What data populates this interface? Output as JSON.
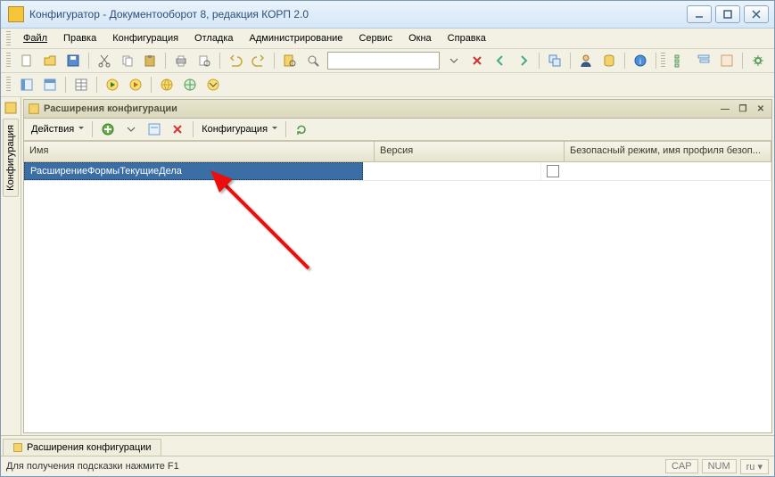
{
  "window": {
    "title": "Конфигуратор - Документооборот 8, редакция КОРП 2.0"
  },
  "menu": {
    "file": "Файл",
    "edit": "Правка",
    "config": "Конфигурация",
    "debug": "Отладка",
    "admin": "Администрирование",
    "service": "Сервис",
    "windows": "Окна",
    "help": "Справка"
  },
  "sidebar": {
    "tab_label": "Конфигурация"
  },
  "child": {
    "title": "Расширения конфигурации",
    "toolbar": {
      "actions": "Действия",
      "config": "Конфигурация"
    },
    "columns": {
      "name": "Имя",
      "version": "Версия",
      "safe": "Безопасный режим, имя профиля безоп..."
    },
    "rows": [
      {
        "name": "РасширениеФормыТекущиеДела",
        "version": "",
        "safe_checked": false
      }
    ]
  },
  "bottom_tab": {
    "label": "Расширения конфигурации"
  },
  "status": {
    "hint": "Для получения подсказки нажмите F1",
    "cap": "CAP",
    "num": "NUM",
    "lang": "ru"
  }
}
